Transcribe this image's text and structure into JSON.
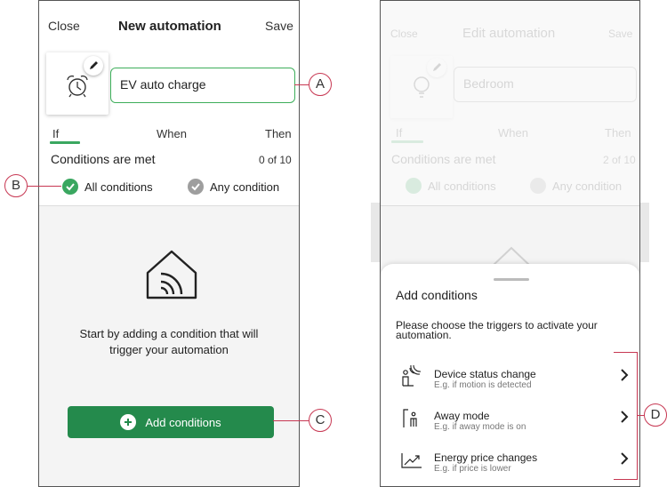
{
  "left_screen": {
    "header": {
      "close": "Close",
      "title": "New automation",
      "save": "Save"
    },
    "name_input": {
      "value": "EV auto charge"
    },
    "tabs": [
      "If",
      "When",
      "Then"
    ],
    "conditions_label": "Conditions are met",
    "conditions_count": "0 of 10",
    "options": {
      "all": "All conditions",
      "any": "Any condition"
    },
    "empty_message": "Start by adding a condition that will trigger your automation",
    "empty_message_line1": "Start by adding a condition that will",
    "empty_message_line2": "trigger your automation",
    "add_button": "Add conditions"
  },
  "right_screen": {
    "header": {
      "close": "Close",
      "title": "Edit automation",
      "save": "Save"
    },
    "name_input": {
      "value": "Bedroom"
    },
    "tabs": [
      "If",
      "When",
      "Then"
    ],
    "conditions_label": "Conditions are met",
    "conditions_count": "2 of 10",
    "options": {
      "all": "All conditions",
      "any": "Any condition"
    },
    "sheet": {
      "title": "Add conditions",
      "description": "Please choose the triggers to activate your automation.",
      "items": [
        {
          "title": "Device status change",
          "subtitle": "E.g. if motion is detected",
          "icon": "device-status-icon"
        },
        {
          "title": "Away mode",
          "subtitle": "E.g. if away mode is on",
          "icon": "away-mode-icon"
        },
        {
          "title": "Energy price changes",
          "subtitle": "E.g. if price is lower",
          "icon": "energy-price-icon"
        }
      ]
    }
  },
  "callouts": [
    "A",
    "B",
    "C",
    "D"
  ],
  "colors": {
    "accent": "#3aa760",
    "button": "#248a4c",
    "callout": "#c73752"
  }
}
